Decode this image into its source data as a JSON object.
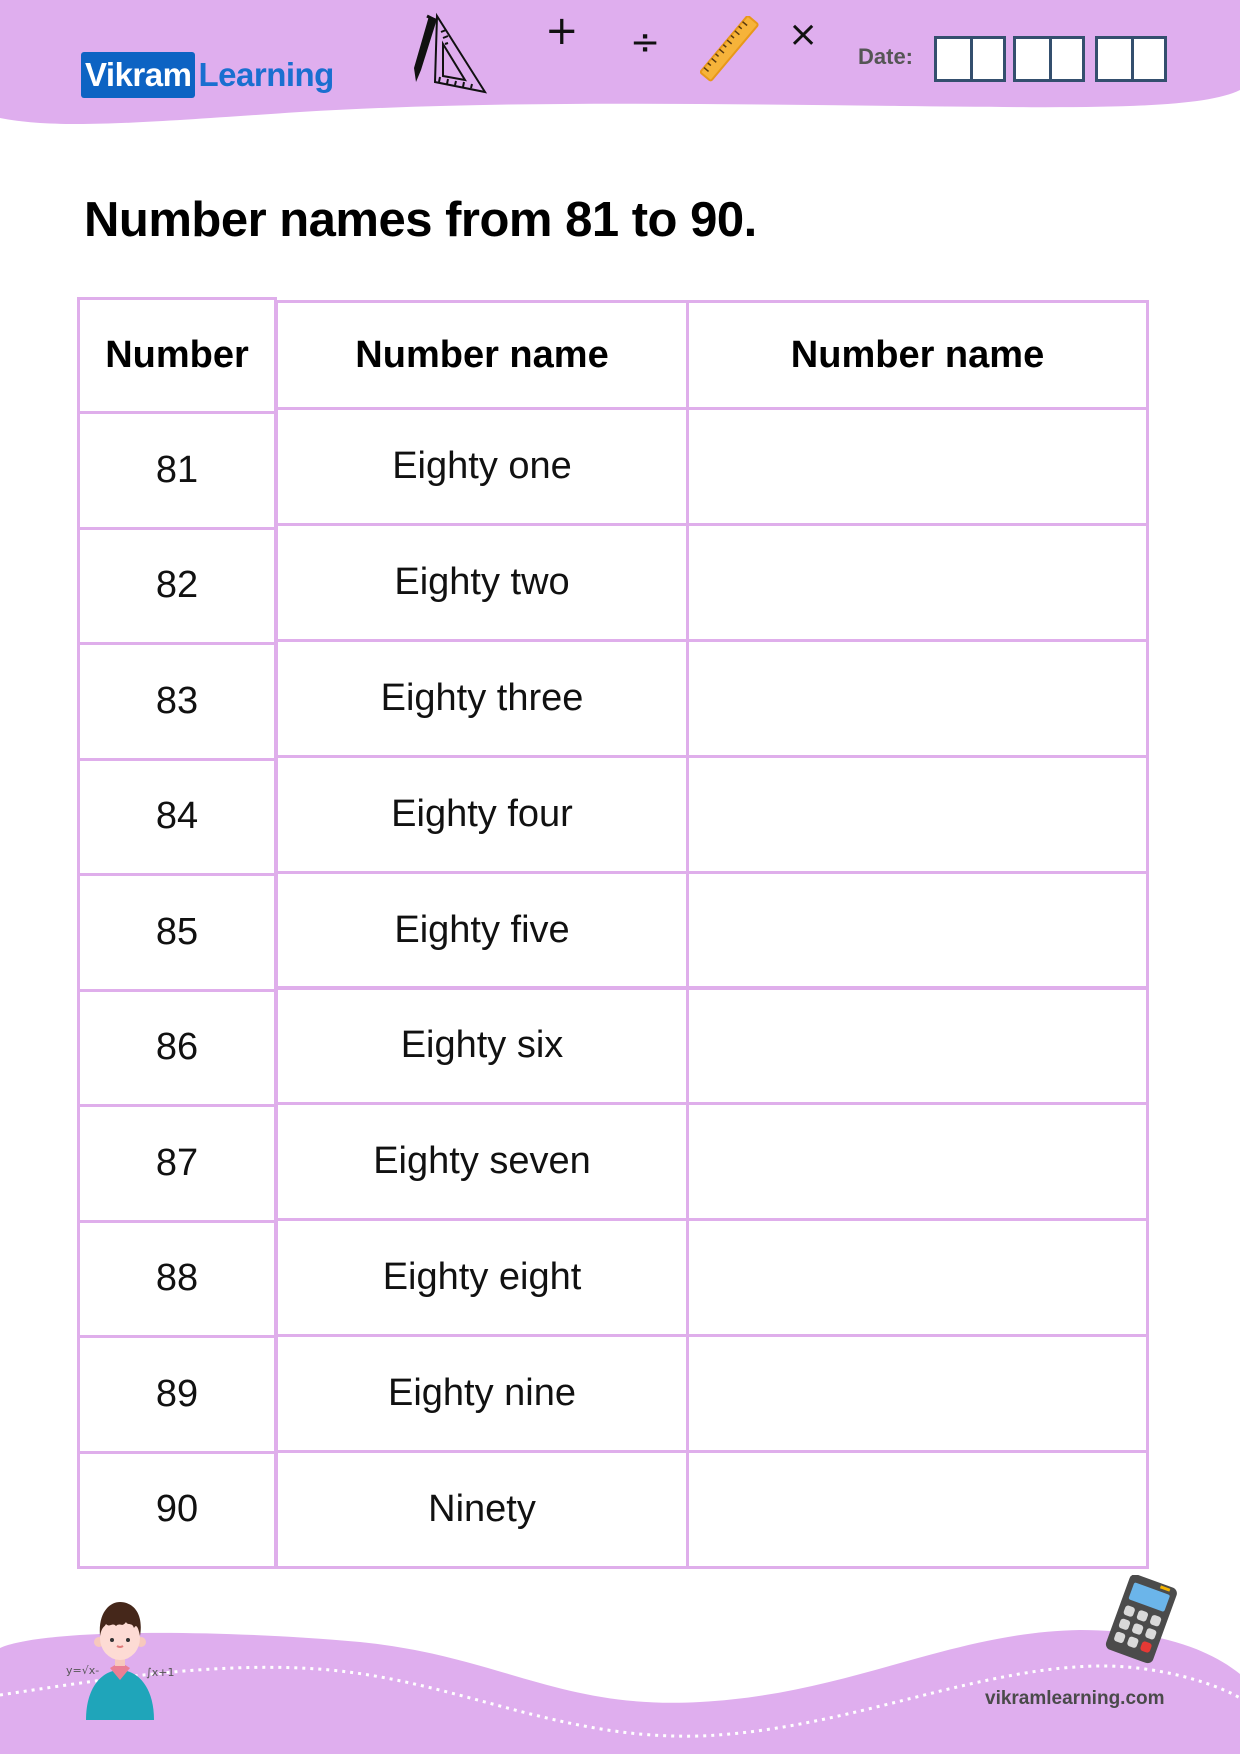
{
  "header": {
    "brand_part1": "Vikram",
    "brand_part2": "Learning",
    "date_label": "Date:",
    "date_groups": [
      [
        "",
        ""
      ],
      [
        "",
        ""
      ],
      [
        "",
        ""
      ]
    ],
    "decorations": [
      "pencil-ruler-triangle-icon",
      "plus-icon",
      "divide-icon",
      "ruler-icon",
      "multiply-icon"
    ],
    "symbols": {
      "plus": "+",
      "divide": "÷",
      "multiply": "×"
    }
  },
  "title": "Number names from 81 to 90.",
  "table": {
    "headers": [
      "Number",
      "Number name",
      "Number name"
    ],
    "rows": [
      {
        "number": "81",
        "name": "Eighty one",
        "answer": ""
      },
      {
        "number": "82",
        "name": "Eighty two",
        "answer": ""
      },
      {
        "number": "83",
        "name": "Eighty three",
        "answer": ""
      },
      {
        "number": "84",
        "name": "Eighty four",
        "answer": ""
      },
      {
        "number": "85",
        "name": "Eighty five",
        "answer": ""
      },
      {
        "number": "86",
        "name": "Eighty six",
        "answer": ""
      },
      {
        "number": "87",
        "name": "Eighty seven",
        "answer": ""
      },
      {
        "number": "88",
        "name": "Eighty eight",
        "answer": ""
      },
      {
        "number": "89",
        "name": "Eighty nine",
        "answer": ""
      },
      {
        "number": "90",
        "name": "Ninety",
        "answer": ""
      }
    ]
  },
  "footer": {
    "url": "vikramlearning.com",
    "decorations": [
      "boy-with-math-formulas-illustration",
      "calculator-icon"
    ]
  },
  "colors": {
    "header_bg": "#dfaeee",
    "table_border": "#dfaeeb",
    "brand_blue": "#0d63c3",
    "date_box_border": "#344f6e"
  }
}
